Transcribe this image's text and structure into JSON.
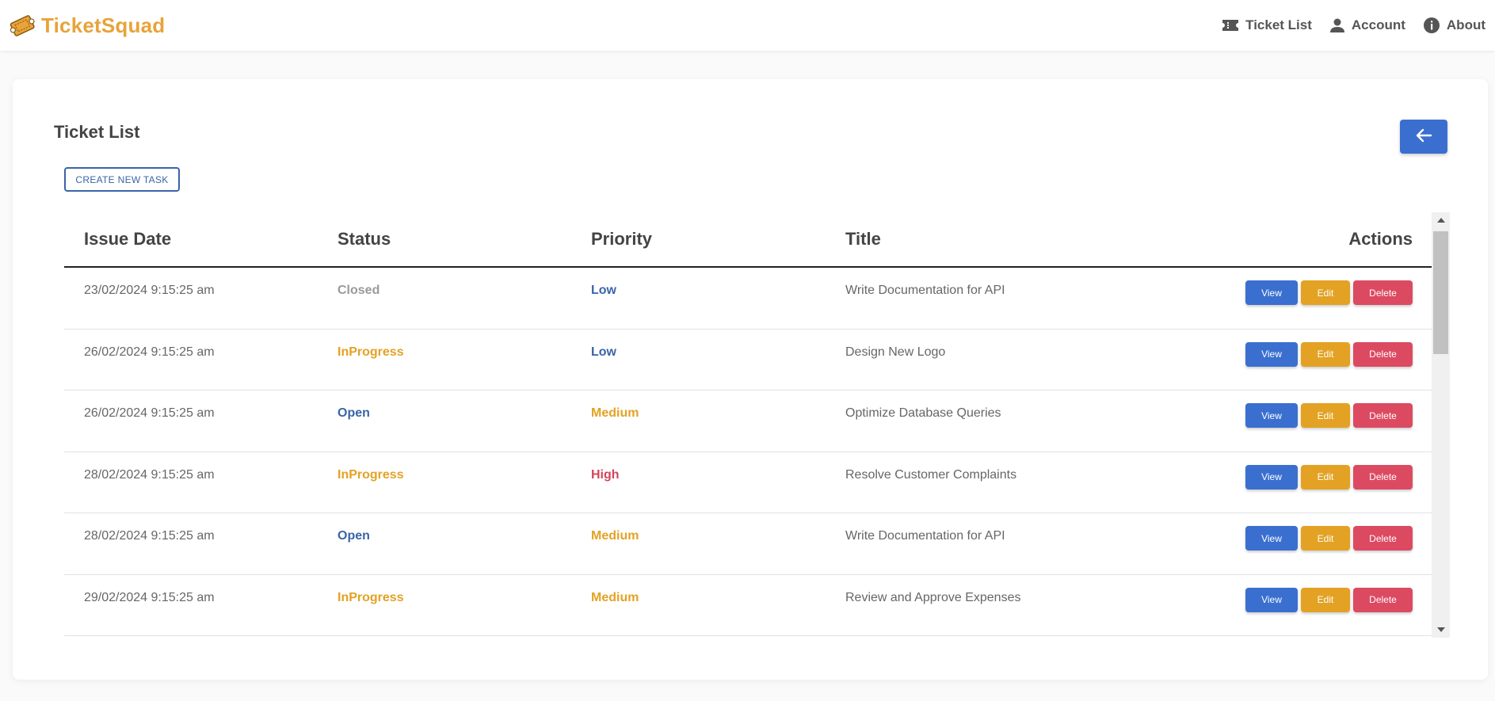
{
  "app": {
    "brand_name": "TicketSquad",
    "brand_color": "#e8a33a"
  },
  "nav": {
    "items": [
      {
        "label": "Ticket List",
        "icon": "ticket-icon"
      },
      {
        "label": "Account",
        "icon": "person-icon"
      },
      {
        "label": "About",
        "icon": "info-icon"
      }
    ]
  },
  "page": {
    "title": "Ticket List",
    "create_button_label": "CREATE NEW TASK",
    "back_button_icon": "arrow-left-icon"
  },
  "table": {
    "headers": {
      "issue_date": "Issue Date",
      "status": "Status",
      "priority": "Priority",
      "title": "Title",
      "actions": "Actions"
    },
    "action_labels": {
      "view": "View",
      "edit": "Edit",
      "delete": "Delete"
    },
    "rows": [
      {
        "issue_date": "23/02/2024 9:15:25 am",
        "status": "Closed",
        "priority": "Low",
        "title": "Write Documentation for API"
      },
      {
        "issue_date": "26/02/2024 9:15:25 am",
        "status": "InProgress",
        "priority": "Low",
        "title": "Design New Logo"
      },
      {
        "issue_date": "26/02/2024 9:15:25 am",
        "status": "Open",
        "priority": "Medium",
        "title": "Optimize Database Queries"
      },
      {
        "issue_date": "28/02/2024 9:15:25 am",
        "status": "InProgress",
        "priority": "High",
        "title": "Resolve Customer Complaints"
      },
      {
        "issue_date": "28/02/2024 9:15:25 am",
        "status": "Open",
        "priority": "Medium",
        "title": "Write Documentation for API"
      },
      {
        "issue_date": "29/02/2024 9:15:25 am",
        "status": "InProgress",
        "priority": "Medium",
        "title": "Review and Approve Expenses"
      }
    ]
  },
  "colors": {
    "status": {
      "Closed": "#9a9a9a",
      "InProgress": "#e3a224",
      "Open": "#3a64a8"
    },
    "priority": {
      "Low": "#3a64a8",
      "Medium": "#e3a224",
      "High": "#d4455c"
    },
    "view_button": "#3a6fd0",
    "edit_button": "#e3a224",
    "delete_button": "#dc4a62"
  }
}
